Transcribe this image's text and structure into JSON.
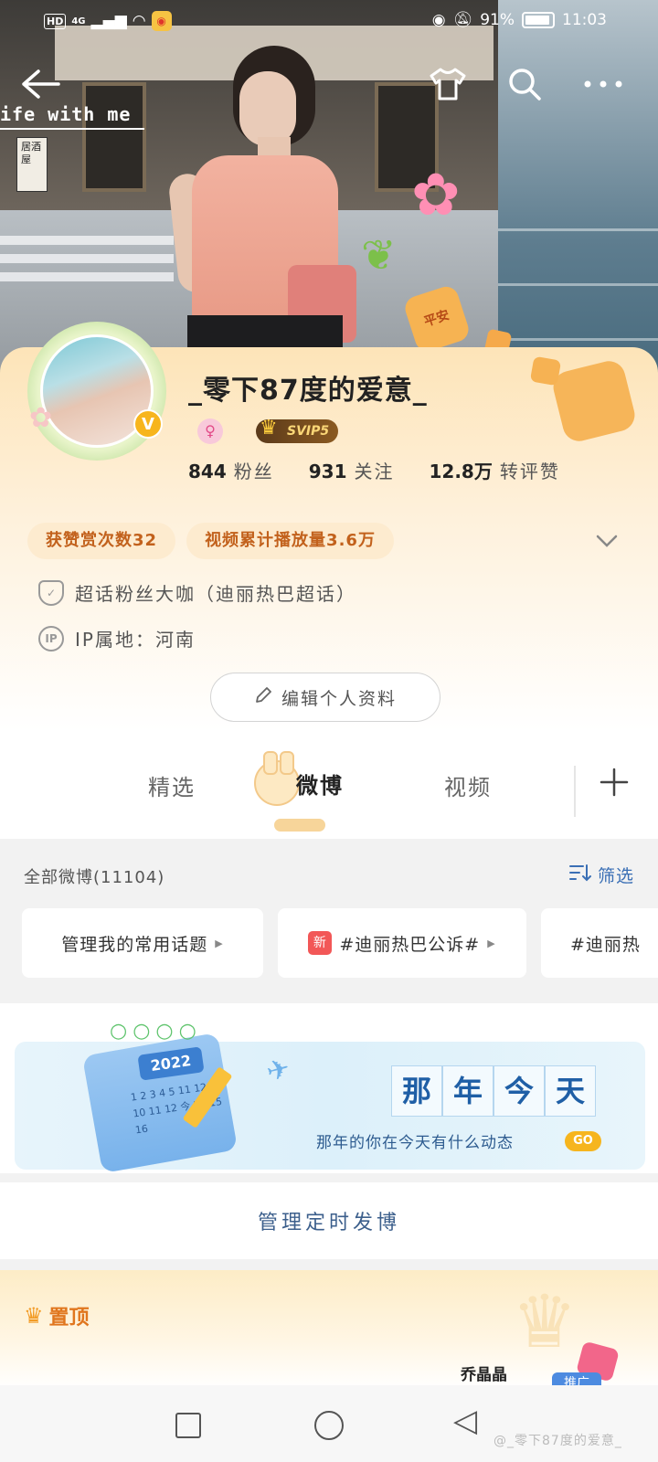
{
  "status_bar": {
    "left_badges": [
      "HD",
      "4G"
    ],
    "battery_percent": "91%",
    "time": "11:03"
  },
  "cover": {
    "watermark_text": "ife with me",
    "sign_text": "居酒屋",
    "lantern_text": "平安"
  },
  "profile": {
    "nickname": "_零下87度的爱意_",
    "vip_label": "SVIP5",
    "verified_mark": "V",
    "stats": [
      {
        "num": "844",
        "label": "粉丝"
      },
      {
        "num": "931",
        "label": "关注"
      },
      {
        "num": "12.8万",
        "label": "转评赞"
      }
    ],
    "chips": [
      "获赞赏次数32",
      "视频累计播放量3.6万"
    ],
    "super_topic": "超话粉丝大咖（迪丽热巴超话）",
    "ip_icon": "IP",
    "ip_location": "IP属地：河南",
    "edit_button": "编辑个人资料"
  },
  "tabs": [
    {
      "label": "精选"
    },
    {
      "label": "微博"
    },
    {
      "label": "视频"
    }
  ],
  "feed": {
    "all_count": "全部微博(11104)",
    "filter_label": "筛选",
    "topics": [
      "管理我的常用话题",
      "#迪丽热巴公诉#",
      "#迪丽热"
    ],
    "new_tag": "新"
  },
  "banner": {
    "year": "2022",
    "calendar_text": "1 2 3 4 5 11 12 8 9 10 11 12 今 20 15 16",
    "title_chars": [
      "那",
      "年",
      "今",
      "天"
    ],
    "subtitle": "那年的你在今天有什么动态",
    "go_label": "GO"
  },
  "manage_scheduled": "管理定时发博",
  "pinned": {
    "label": "置顶",
    "promo_name": "乔晶晶",
    "promo_tag": "推广"
  },
  "credit": "@_零下87度的爱意_"
}
